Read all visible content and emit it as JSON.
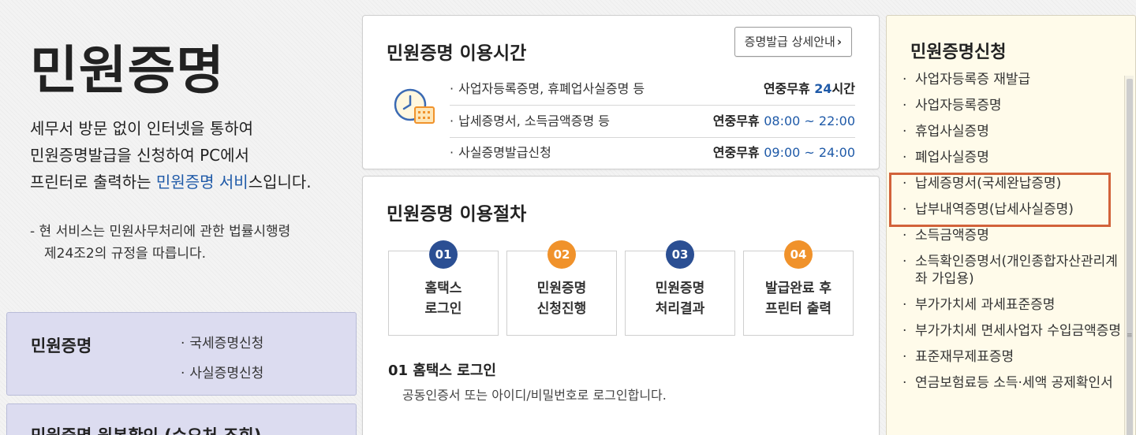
{
  "page": {
    "title": "민원증명",
    "intro_lines": [
      "세무서 방문 없이 인터넷을 통하여",
      "민원증명발급을 신청하여 PC에서"
    ],
    "intro_line3_prefix": "프린터로 출력하는 ",
    "intro_line3_highlight": "민원증명 서비",
    "intro_line3_suffix": "스입니다.",
    "law_line1": "- 현 서비스는 민원사무처리에 관한 법률시행령",
    "law_line2": "제24조2의 규정을 따릅니다."
  },
  "left_boxes": {
    "certificate": {
      "title": "민원증명",
      "links": [
        "국세증명신청",
        "사실증명신청"
      ]
    },
    "verify": {
      "title": "민원증명 원본확인 (수요처 조회)"
    }
  },
  "hours": {
    "title": "민원증명 이용시간",
    "detail_button": "증명발급 상세안내",
    "rows": [
      {
        "name": "사업자등록증명, 휴폐업사실증명 등",
        "label": "연중무휴 ",
        "value": "24",
        "suffix": "시간"
      },
      {
        "name": "납세증명서, 소득금액증명 등",
        "label": "연중무휴 ",
        "value": "08:00 ~ 22:00",
        "suffix": ""
      },
      {
        "name": "사실증명발급신청",
        "label": "연중무휴 ",
        "value": "09:00 ~ 24:00",
        "suffix": ""
      }
    ]
  },
  "procedure": {
    "title": "민원증명 이용절차",
    "steps": [
      {
        "num": "01",
        "label": "홈택스\n로그인",
        "color": "#2b4f93"
      },
      {
        "num": "02",
        "label": "민원증명\n신청진행",
        "color": "#f0922b"
      },
      {
        "num": "03",
        "label": "민원증명\n처리결과",
        "color": "#2b4f93"
      },
      {
        "num": "04",
        "label": "발급완료 후\n프린터 출력",
        "color": "#f0922b"
      }
    ],
    "detail_title": "01 홈택스 로그인",
    "detail_text": "공동인증서 또는 아이디/비밀번호로 로그인합니다."
  },
  "apply": {
    "title": "민원증명신청",
    "items": [
      "사업자등록증 재발급",
      "사업자등록증명",
      "휴업사실증명",
      "폐업사실증명",
      "납세증명서(국세완납증명)",
      "납부내역증명(납세사실증명)",
      "소득금액증명",
      "소득확인증명서(개인종합자산관리계좌 가입용)",
      "부가가치세 과세표준증명",
      "부가가치세 면세사업자 수입금액증명",
      "표준재무제표증명",
      "연금보험료등 소득·세액 공제확인서"
    ]
  },
  "colors": {
    "accent_blue": "#1f5aa8",
    "step_blue": "#2b4f93",
    "step_orange": "#f0922b",
    "highlight_frame": "#d2623a"
  }
}
